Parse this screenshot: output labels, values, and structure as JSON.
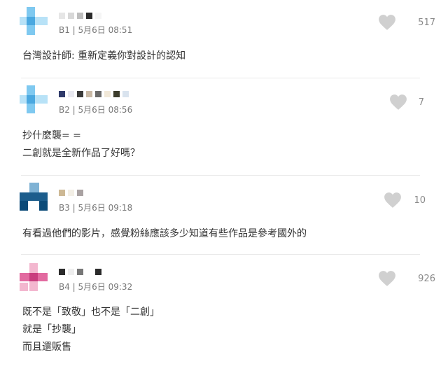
{
  "comments": [
    {
      "floor_meta": "B1 | 5月6日 08:51",
      "likes": "517",
      "lines": [
        "台灣設計師: 重新定義你對設計的認知"
      ],
      "avatar_colors": [
        "#7fc9f0",
        "#b8e2f7",
        "#4aa8e0"
      ],
      "name_blocks": [
        "#e6e6e6",
        "#d8d8d8",
        "#bdbdbd",
        "#2b2b2b",
        "#ffffff"
      ]
    },
    {
      "floor_meta": "B2 | 5月6日 08:56",
      "likes": "7",
      "lines": [
        "抄什麼襲= =",
        "二創就是全新作品了好嗎？"
      ],
      "avatar_colors": [
        "#7fc9f0",
        "#b8e2f7",
        "#4aa8e0"
      ],
      "name_blocks": [
        "#2f3a6a",
        "#e8e8f0",
        "#3a3a3a",
        "#c9b9a6",
        "#6a6a6a",
        "#f1e8d8",
        "#3d3d2c",
        "#d9e3ee"
      ]
    },
    {
      "floor_meta": "B3 | 5月6日 09:18",
      "likes": "10",
      "lines": [
        "有看過他們的影片，感覺粉絲應該多少知道有些作品是參考國外的"
      ],
      "avatar_colors": [
        "#1c5d8c",
        "#7fb2d4",
        "#0b4a78"
      ],
      "name_blocks": [
        "#cdb894",
        "#f3efe6",
        "#a9a2a2"
      ]
    },
    {
      "floor_meta": "B4 | 5月6日 09:32",
      "likes": "926",
      "lines": [
        "既不是「致敬」也不是「二創」",
        "就是「抄襲」",
        "而且還販售"
      ],
      "avatar_colors": [
        "#e26aa0",
        "#f3b7cf",
        "#c93d7e"
      ],
      "name_blocks": [
        "#2b2b2b",
        "#eeeeee",
        "#777777",
        "#ffffff",
        "#2b2b2b"
      ]
    }
  ],
  "icons": {
    "like": "heart-icon"
  },
  "colors": {
    "heart": "#d0d0d0",
    "meta_text": "#777777",
    "divider": "#e8e8e8"
  }
}
